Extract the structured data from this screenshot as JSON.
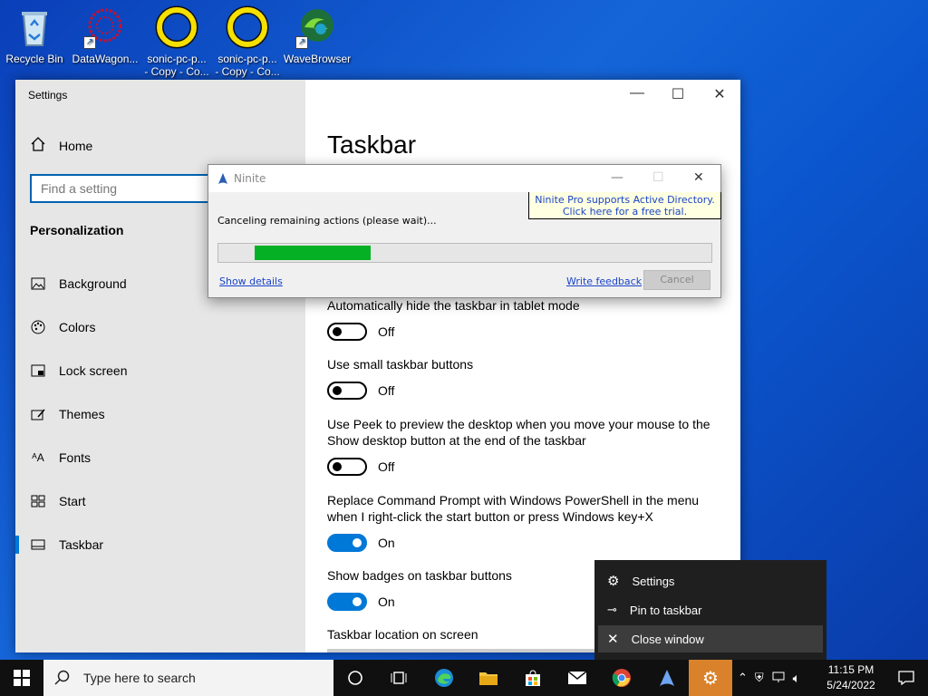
{
  "desktop": {
    "icons": [
      {
        "label": "Recycle Bin"
      },
      {
        "label": "DataWagon..."
      },
      {
        "label": "sonic-pc-p...\n- Copy - Co..."
      },
      {
        "label": "sonic-pc-p...\n- Copy - Co..."
      },
      {
        "label": "WaveBrowser"
      }
    ]
  },
  "settings": {
    "window_title": "Settings",
    "home_label": "Home",
    "search_placeholder": "Find a setting",
    "section_heading": "Personalization",
    "nav": [
      {
        "label": "Background",
        "icon": "picture-icon"
      },
      {
        "label": "Colors",
        "icon": "palette-icon"
      },
      {
        "label": "Lock screen",
        "icon": "lock-screen-icon"
      },
      {
        "label": "Themes",
        "icon": "themes-icon"
      },
      {
        "label": "Fonts",
        "icon": "fonts-icon"
      },
      {
        "label": "Start",
        "icon": "start-icon"
      },
      {
        "label": "Taskbar",
        "icon": "taskbar-icon",
        "selected": true
      }
    ],
    "page_title": "Taskbar",
    "options": [
      {
        "label": "Automatically hide the taskbar in tablet mode",
        "state": "Off",
        "on": false
      },
      {
        "label": "Use small taskbar buttons",
        "state": "Off",
        "on": false
      },
      {
        "label": "Use Peek to preview the desktop when you move your mouse to the Show desktop button at the end of the taskbar",
        "state": "Off",
        "on": false
      },
      {
        "label": "Replace Command Prompt with Windows PowerShell in the menu when I right-click the start button or press Windows key+X",
        "state": "On",
        "on": true
      },
      {
        "label": "Show badges on taskbar buttons",
        "state": "On",
        "on": true
      }
    ],
    "location_label": "Taskbar location on screen"
  },
  "ninite": {
    "title": "Ninite",
    "promo_line1": "Ninite Pro supports Active Directory.",
    "promo_line2": "Click here for a free trial.",
    "status": "Canceling remaining actions (please wait)...",
    "progress_start": 0.073,
    "progress_end": 0.307,
    "show_details": "Show details",
    "write_feedback": "Write feedback",
    "cancel": "Cancel"
  },
  "jumplist": {
    "items": [
      {
        "label": "Settings",
        "icon": "gear-icon"
      },
      {
        "label": "Pin to taskbar",
        "icon": "pin-icon"
      },
      {
        "label": "Close window",
        "icon": "close-icon"
      }
    ]
  },
  "taskbar": {
    "search_placeholder": "Type here to search",
    "time": "11:15 PM",
    "date": "5/24/2022"
  },
  "colors": {
    "accent": "#0078d7",
    "progress": "#06b025",
    "active_taskbar": "#d9822b"
  }
}
